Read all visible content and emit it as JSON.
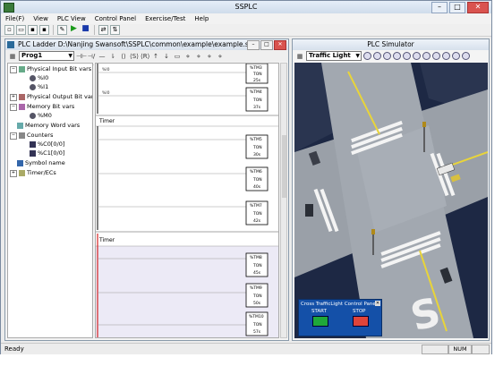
{
  "window": {
    "title": "SSPLC"
  },
  "menu": [
    "File(F)",
    "View",
    "PLC View",
    "Control Panel",
    "Exercise/Test",
    "Help"
  ],
  "ladder": {
    "title": "PLC Ladder  D:\\Nanjing Swansoft\\SSPLC\\common\\example\\example.ssp",
    "program_select": "Prog1",
    "tree": {
      "physical_input": "Physical Input Bit vars",
      "input_items": [
        "%I0",
        "%I1"
      ],
      "physical_output": "Physical Output Bit vars",
      "memory_bit": "Memory Bit vars",
      "memory_items": [
        "%M0"
      ],
      "memory_word": "Memory Word vars",
      "counters": "Counters",
      "counter_items": [
        "%C0[0/0]",
        "%C1[0/0]"
      ],
      "symbol_name": "Symbol name",
      "timer_ecs": "Timer/ECs"
    },
    "sections": [
      "Timer",
      "Timer"
    ],
    "timers": [
      {
        "name": "%TM3",
        "mode": "TON",
        "preset": "25s"
      },
      {
        "name": "%TM4",
        "mode": "TON",
        "preset": "37s"
      },
      {
        "name": "%TM5",
        "mode": "TON",
        "preset": "30s"
      },
      {
        "name": "%TM6",
        "mode": "TON",
        "preset": "40s"
      },
      {
        "name": "%TM7",
        "mode": "TON",
        "preset": "42s"
      },
      {
        "name": "%TM8",
        "mode": "TON",
        "preset": "45s"
      },
      {
        "name": "%TM9",
        "mode": "TON",
        "preset": "50s"
      },
      {
        "name": "%TM10",
        "mode": "TON",
        "preset": "57s"
      }
    ]
  },
  "simulator": {
    "title": "PLC Simulator",
    "scene_select": "Traffic Light",
    "panel": {
      "title": "Cross TrafficLight Control Panel",
      "start_label": "START",
      "stop_label": "STOP",
      "start_color": "#1fa83a",
      "stop_color": "#e0443a"
    }
  },
  "status": {
    "left": "Ready",
    "num": "NUM"
  }
}
